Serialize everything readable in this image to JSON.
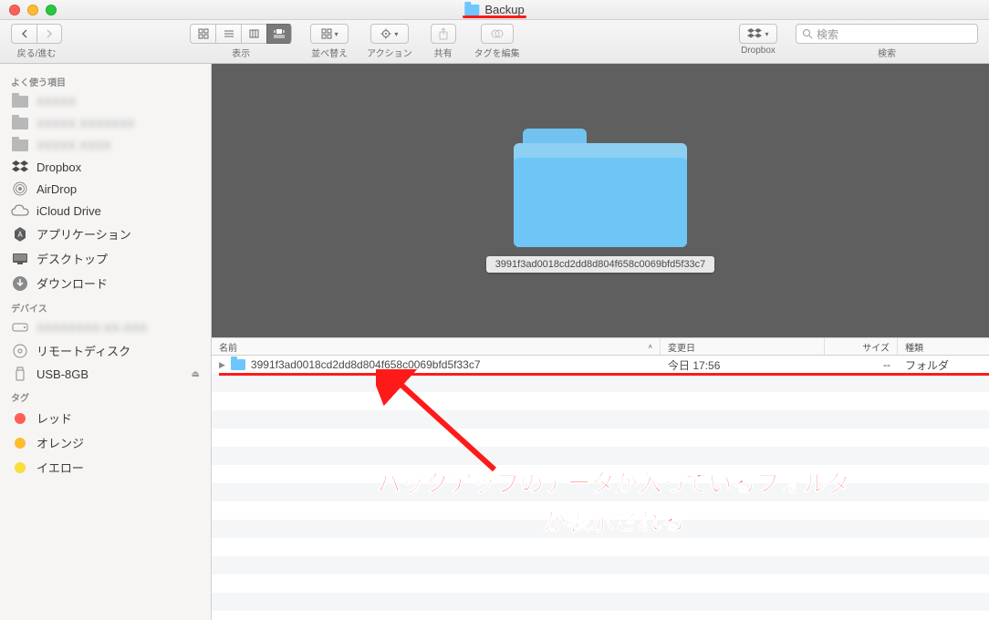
{
  "window": {
    "title": "Backup"
  },
  "toolbar": {
    "nav_label": "戻る/進む",
    "view_label": "表示",
    "arrange_label": "並べ替え",
    "action_label": "アクション",
    "share_label": "共有",
    "tags_label": "タグを編集",
    "dropbox_label": "Dropbox",
    "search_label": "検索",
    "search_placeholder": "検索"
  },
  "sidebar": {
    "favorites_header": "よく使う項目",
    "favorites": [
      {
        "label": "XXXXX",
        "blurred": true,
        "icon": "folder"
      },
      {
        "label": "XXXXX XXXXXXX",
        "blurred": true,
        "icon": "folder"
      },
      {
        "label": "XXXXX XXXX",
        "blurred": true,
        "icon": "folder"
      },
      {
        "label": "Dropbox",
        "icon": "dropbox"
      },
      {
        "label": "AirDrop",
        "icon": "airdrop"
      },
      {
        "label": "iCloud Drive",
        "icon": "cloud"
      },
      {
        "label": "アプリケーション",
        "icon": "app"
      },
      {
        "label": "デスクトップ",
        "icon": "desktop"
      },
      {
        "label": "ダウンロード",
        "icon": "download"
      }
    ],
    "devices_header": "デバイス",
    "devices": [
      {
        "label": "XXXXXXXX-XX-XXX",
        "blurred": true,
        "icon": "disk"
      },
      {
        "label": "リモートディスク",
        "icon": "cd"
      },
      {
        "label": "USB-8GB",
        "icon": "usb",
        "eject": true
      }
    ],
    "tags_header": "タグ",
    "tags": [
      {
        "label": "レッド",
        "color": "tag-red"
      },
      {
        "label": "オレンジ",
        "color": "tag-orange"
      },
      {
        "label": "イエロー",
        "color": "tag-yellow"
      }
    ]
  },
  "columns": {
    "name": "名前",
    "modified": "変更日",
    "size": "サイズ",
    "kind": "種類"
  },
  "item": {
    "name": "3991f3ad0018cd2dd8d804f658c0069bfd5f33c7",
    "modified": "今日 17:56",
    "size": "--",
    "kind": "フォルダ"
  },
  "annotation": {
    "line1": "バックアップのデータが入っているフォルダ",
    "line2": "が表示される"
  }
}
